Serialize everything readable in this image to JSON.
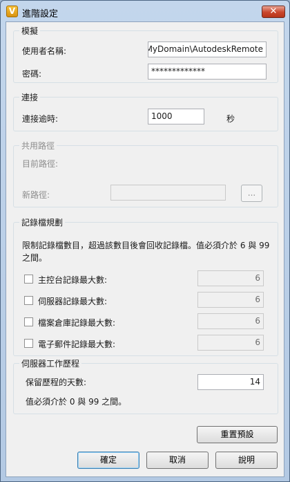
{
  "window": {
    "title": "進階設定",
    "app_icon_glyph": "V",
    "close_glyph": "✕"
  },
  "impersonation": {
    "title": "模擬",
    "username_label": "使用者名稱:",
    "username_value": "MyDomain\\AutodeskRemote",
    "password_label": "密碼:",
    "password_value": "*************"
  },
  "connection": {
    "title": "連接",
    "timeout_label": "連接逾時:",
    "timeout_value": "1000",
    "timeout_unit": "秒"
  },
  "share_path": {
    "title": "共用路徑",
    "current_label": "目前路徑:",
    "new_label": "新路徑:",
    "new_value": "",
    "browse_label": "..."
  },
  "log_policy": {
    "title": "記錄檔規劃",
    "description_line1": "限制記錄檔數目，超過該數目後會回收記錄檔。值必須介於 6 與 99",
    "description_line2": "之間。",
    "items": [
      {
        "label": "主控台記錄最大數:",
        "value": "6",
        "checked": false
      },
      {
        "label": "伺服器記錄最大數:",
        "value": "6",
        "checked": false
      },
      {
        "label": "檔案倉庫記錄最大數:",
        "value": "6",
        "checked": false
      },
      {
        "label": "電子郵件記錄最大數:",
        "value": "6",
        "checked": false
      }
    ]
  },
  "history": {
    "title": "伺服器工作歷程",
    "days_label": "保留歷程的天數:",
    "days_value": "14",
    "note": "值必須介於 0 與 99 之間。"
  },
  "buttons": {
    "reset": "重置預設",
    "ok": "確定",
    "cancel": "取消",
    "help": "說明"
  }
}
